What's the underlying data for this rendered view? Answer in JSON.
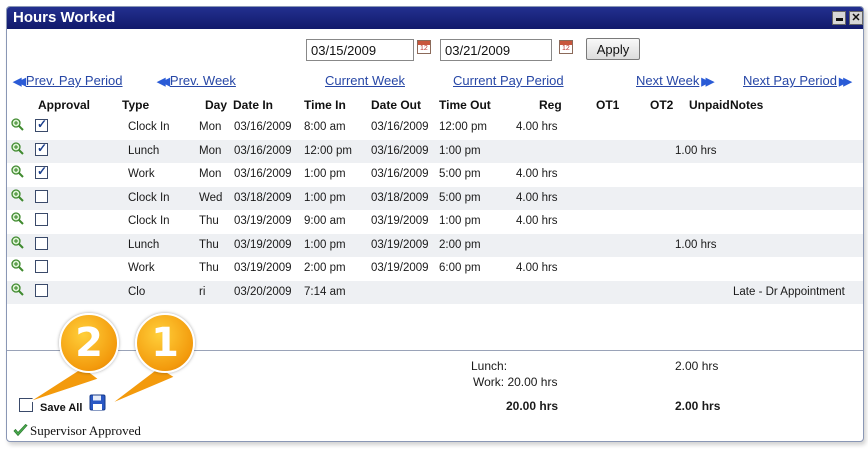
{
  "window": {
    "title": "Hours Worked",
    "minimize_label": "",
    "close_label": "✕"
  },
  "filters": {
    "start_date": "03/15/2009",
    "end_date": "03/21/2009",
    "calendar_badge": "12",
    "apply_label": "Apply"
  },
  "nav": {
    "prev_pay_period": "Prev. Pay Period",
    "prev_week": "Prev. Week",
    "current_week": "Current Week",
    "current_pay_period": "Current Pay Period",
    "next_week": "Next Week",
    "next_pay_period": "Next Pay Period"
  },
  "columns": [
    "Approval",
    "Type",
    "Day",
    "Date In",
    "Time In",
    "Date Out",
    "Time Out",
    "Reg",
    "OT1",
    "OT2",
    "Unpaid",
    "Notes"
  ],
  "rows": [
    {
      "approved": true,
      "type": "Clock In",
      "day": "Mon",
      "date_in": "03/16/2009",
      "time_in": "8:00 am",
      "date_out": "03/16/2009",
      "time_out": "12:00 pm",
      "reg": "4.00 hrs",
      "unpaid": "",
      "notes": ""
    },
    {
      "approved": true,
      "type": "Lunch",
      "day": "Mon",
      "date_in": "03/16/2009",
      "time_in": "12:00 pm",
      "date_out": "03/16/2009",
      "time_out": "1:00 pm",
      "reg": "",
      "unpaid": "1.00 hrs",
      "notes": ""
    },
    {
      "approved": true,
      "type": "Work",
      "day": "Mon",
      "date_in": "03/16/2009",
      "time_in": "1:00 pm",
      "date_out": "03/16/2009",
      "time_out": "5:00 pm",
      "reg": "4.00 hrs",
      "unpaid": "",
      "notes": ""
    },
    {
      "approved": false,
      "type": "Clock In",
      "day": "Wed",
      "date_in": "03/18/2009",
      "time_in": "1:00 pm",
      "date_out": "03/18/2009",
      "time_out": "5:00 pm",
      "reg": "4.00 hrs",
      "unpaid": "",
      "notes": ""
    },
    {
      "approved": false,
      "type": "Clock In",
      "day": "Thu",
      "date_in": "03/19/2009",
      "time_in": "9:00 am",
      "date_out": "03/19/2009",
      "time_out": "1:00 pm",
      "reg": "4.00 hrs",
      "unpaid": "",
      "notes": ""
    },
    {
      "approved": false,
      "type": "Lunch",
      "day": "Thu",
      "date_in": "03/19/2009",
      "time_in": "1:00 pm",
      "date_out": "03/19/2009",
      "time_out": "2:00 pm",
      "reg": "",
      "unpaid": "1.00 hrs",
      "notes": ""
    },
    {
      "approved": false,
      "type": "Work",
      "day": "Thu",
      "date_in": "03/19/2009",
      "time_in": "2:00 pm",
      "date_out": "03/19/2009",
      "time_out": "6:00 pm",
      "reg": "4.00 hrs",
      "unpaid": "",
      "notes": ""
    },
    {
      "approved": false,
      "type": "Clo",
      "day": "ri",
      "date_in": "03/20/2009",
      "time_in": "7:14 am",
      "date_out": "",
      "time_out": "",
      "reg": "",
      "unpaid": "",
      "notes": "Late - Dr Appointment"
    }
  ],
  "totals": {
    "lunch_label": "Lunch:",
    "work_label": "Work: 20.00 hrs",
    "unpaid_lunch": "2.00 hrs",
    "reg_total": "20.00 hrs",
    "unpaid_total": "2.00 hrs"
  },
  "footer": {
    "save_all_label": "Save All",
    "supervisor_approved": "Supervisor Approved"
  },
  "callouts": [
    "2",
    "1"
  ],
  "colors": {
    "titlebar": "#1a237e",
    "link": "#2747a6",
    "callout": "#f39a0c",
    "alt_row": "#eef0f3"
  }
}
